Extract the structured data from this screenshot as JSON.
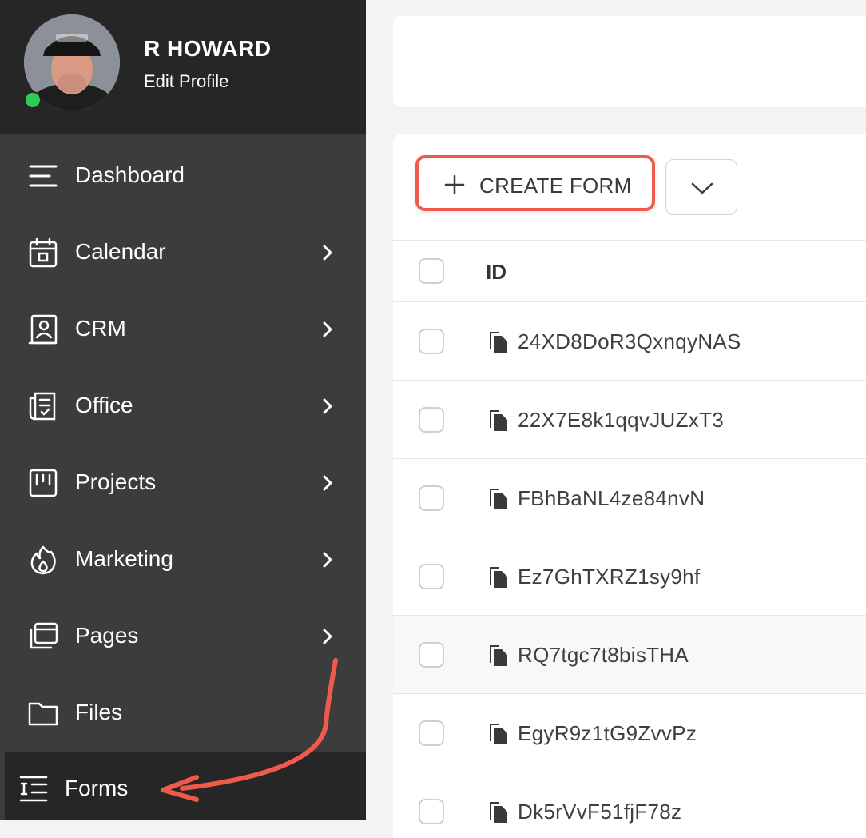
{
  "profile": {
    "name": "R HOWARD",
    "edit_label": "Edit Profile"
  },
  "sidebar": {
    "items": [
      {
        "label": "Dashboard",
        "icon": "menu-lines-icon",
        "has_submenu": false
      },
      {
        "label": "Calendar",
        "icon": "calendar-icon",
        "has_submenu": true
      },
      {
        "label": "CRM",
        "icon": "contact-book-icon",
        "has_submenu": true
      },
      {
        "label": "Office",
        "icon": "receipt-icon",
        "has_submenu": true
      },
      {
        "label": "Projects",
        "icon": "kanban-board-icon",
        "has_submenu": true
      },
      {
        "label": "Marketing",
        "icon": "flame-icon",
        "has_submenu": true
      },
      {
        "label": "Pages",
        "icon": "pages-stack-icon",
        "has_submenu": true
      },
      {
        "label": "Files",
        "icon": "folder-icon",
        "has_submenu": false
      },
      {
        "label": "Forms",
        "icon": "form-list-icon",
        "has_submenu": false,
        "active": true
      }
    ]
  },
  "toolbar": {
    "create_label": "CREATE FORM"
  },
  "table": {
    "header_id": "ID",
    "rows": [
      {
        "id": "24XD8DoR3QxnqyNAS"
      },
      {
        "id": "22X7E8k1qqvJUZxT3"
      },
      {
        "id": "FBhBaNL4ze84nvN"
      },
      {
        "id": "Ez7GhTXRZ1sy9hf"
      },
      {
        "id": "RQ7tgc7t8bisTHA"
      },
      {
        "id": "EgyR9z1tG9ZvvPz"
      },
      {
        "id": "Dk5rVvF51fjF78z"
      }
    ]
  },
  "colors": {
    "sidebar_bg": "#3c3c3c",
    "sidebar_header_bg": "#262626",
    "annotation_red": "#f05a4c",
    "online_green": "#2ecc55"
  }
}
